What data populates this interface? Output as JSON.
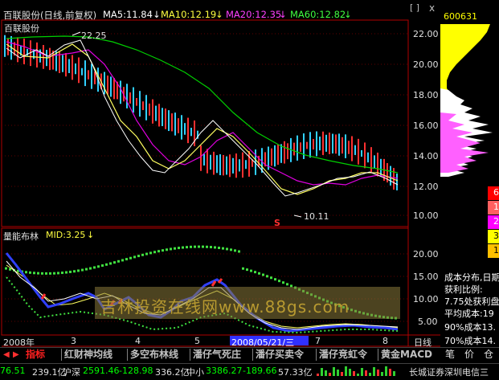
{
  "header": {
    "stock_name": "百联股份(日线,前复权)",
    "ma5": "MA5:11.84",
    "ma10": "MA10:12.19",
    "ma20": "MA20:12.35",
    "ma60": "MA60:12.82",
    "down_arrow": "↓",
    "right_icons": [
      "[ ]",
      "x"
    ]
  },
  "price_chart": {
    "name_label": "百联股份",
    "high_label": "22.25",
    "low_label": "10.11",
    "marker_s": "S",
    "y_ticks": [
      "22.00",
      "20.00",
      "18.00",
      "16.00",
      "14.00",
      "12.00",
      "10.00"
    ]
  },
  "indicator": {
    "label": "量能布林",
    "mid": "MID:3.25",
    "arrow": "↓",
    "y_ticks": [
      "20.00",
      "15.00",
      "10.00",
      "5.00"
    ],
    "watermark": "吉林投资在线网www.88gs.com"
  },
  "xaxis": {
    "labels": [
      "2008年",
      "3",
      "4",
      "5",
      "2008/05/21/三",
      "7",
      "8"
    ],
    "period": "日线"
  },
  "right_panel": {
    "code": "600631",
    "cost_labels": [
      "成本分布,日期",
      "获利比例:",
      "7.75处获利盘",
      "平均成本:19",
      "90%成本13.",
      "70%成本14."
    ],
    "color_legend": [
      {
        "label": "6",
        "color": "#ff0000"
      },
      {
        "label": "1",
        "color": "#ff6060"
      },
      {
        "label": "2",
        "color": "#ff00ff"
      },
      {
        "label": "3",
        "color": "#ffff00"
      },
      {
        "label": "1",
        "color": "#ffc000"
      }
    ]
  },
  "tabs": [
    {
      "label": "指标",
      "active": true
    },
    {
      "label": "红财神均线"
    },
    {
      "label": "多空布林线"
    },
    {
      "label": "潘仔气死庄"
    },
    {
      "label": "潘仔买卖令"
    },
    {
      "label": "潘仔竞虹令"
    },
    {
      "label": "黄金MACD"
    }
  ],
  "right_buttons": [
    "笔",
    "价",
    "仓"
  ],
  "status": {
    "index1_value": "76.51",
    "index1_vol": "239.1亿",
    "shsz_label": "沪深",
    "shsz_value": "2591.46",
    "shsz_change": "-128.98",
    "shsz_vol": "336.2亿",
    "sme_label": "中小",
    "sme_value": "3386.27",
    "sme_change": "-189.66",
    "sme_vol": "57.33亿",
    "broker": "长城证券深圳电信三"
  }
}
